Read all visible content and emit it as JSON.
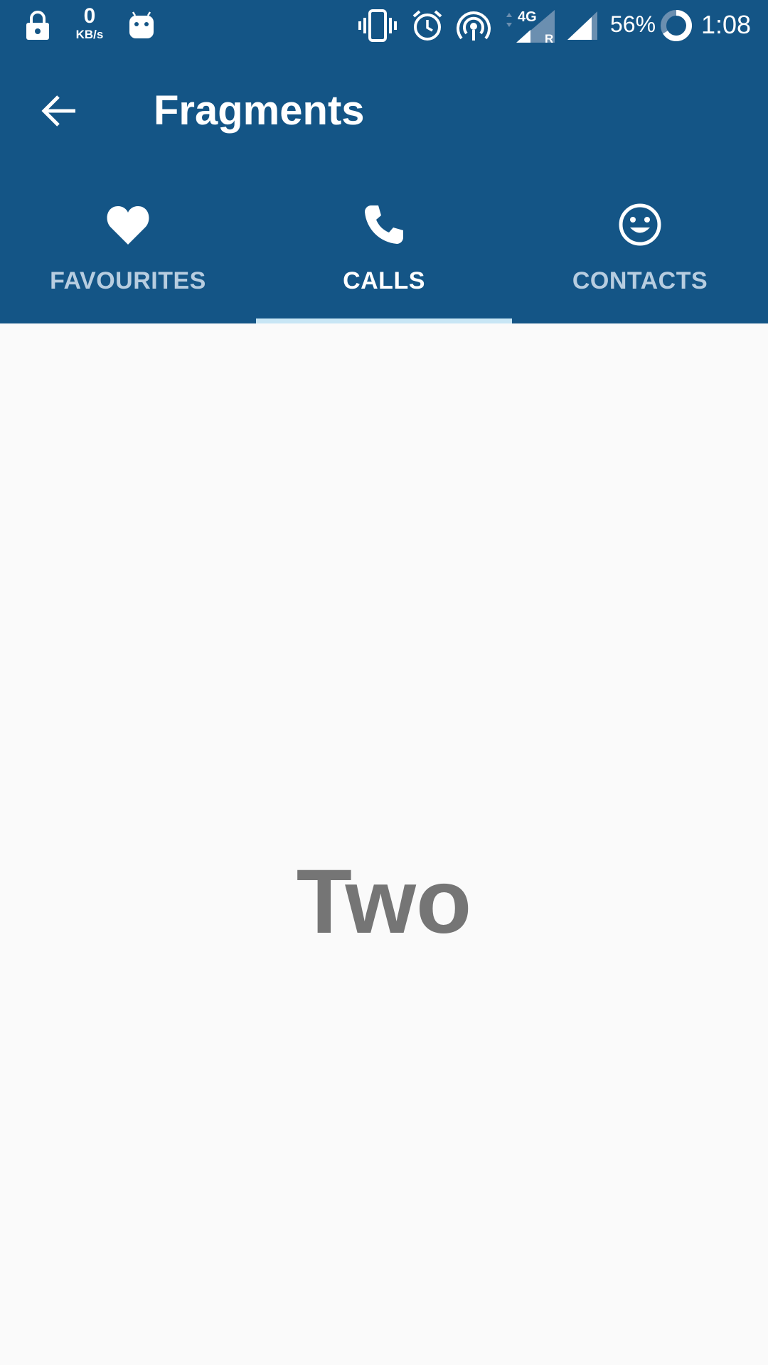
{
  "status_bar": {
    "net_speed_value": "0",
    "net_speed_unit": "KB/s",
    "network_type": "4G",
    "roaming_indicator": "R",
    "battery_percent": "56%",
    "time": "1:08",
    "icons": [
      "lock-icon",
      "android-icon",
      "vibrate-icon",
      "alarm-icon",
      "hotspot-icon",
      "signal-4g-icon",
      "signal-icon",
      "battery-icon"
    ]
  },
  "toolbar": {
    "title": "Fragments",
    "back_icon": "arrow-back-icon"
  },
  "tabs": [
    {
      "label": "FAVOURITES",
      "icon": "heart-icon",
      "active": false
    },
    {
      "label": "CALLS",
      "icon": "phone-icon",
      "active": true
    },
    {
      "label": "CONTACTS",
      "icon": "smiley-icon",
      "active": false
    }
  ],
  "content": {
    "text": "Two"
  },
  "colors": {
    "primary": "#145586",
    "indicator": "#c8e6f5",
    "inactive_tab_text": "#b7cde0",
    "content_text": "#757575",
    "background": "#fafafa"
  }
}
